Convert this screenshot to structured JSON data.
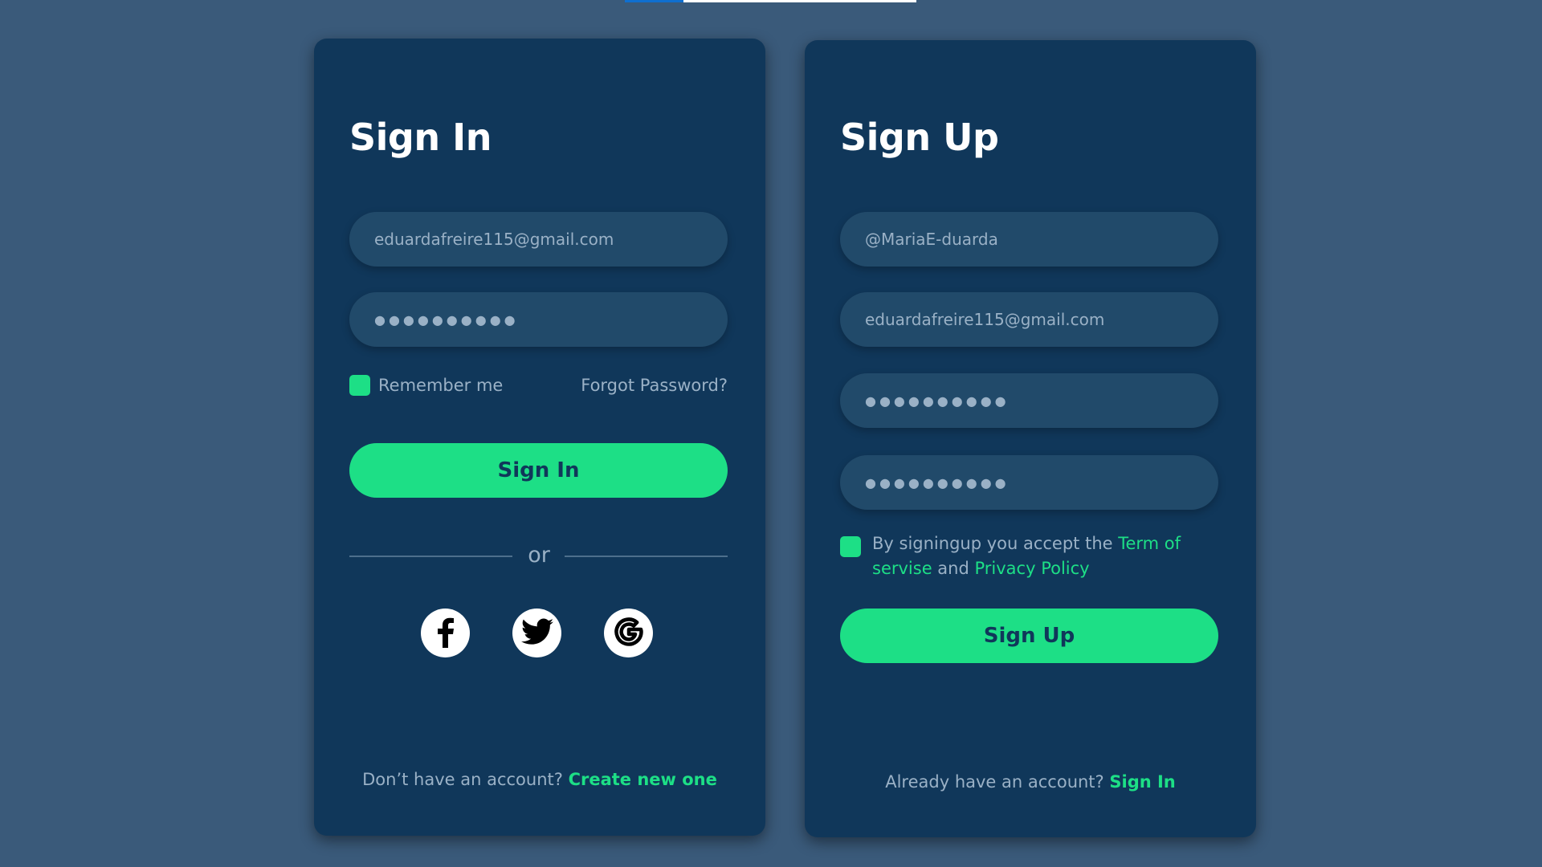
{
  "colors": {
    "background": "#3a5a7a",
    "card": "#10375a",
    "field": "#214a6a",
    "accent": "#1ddf86",
    "muted_text": "#9ab1c6"
  },
  "signin": {
    "title": "Sign In",
    "email_value": "eduardafreire115@gmail.com",
    "password_value": "●●●●●●●●●●",
    "remember_label": "Remember me",
    "forgot_label": "Forgot Password?",
    "button_label": "Sign In",
    "divider_text": "or",
    "social": [
      {
        "icon": "facebook-icon"
      },
      {
        "icon": "twitter-icon"
      },
      {
        "icon": "google-icon"
      }
    ],
    "footer_text": "Don’t have an account? ",
    "footer_link": "Create new one"
  },
  "signup": {
    "title": "Sign Up",
    "username_value": "@MariaE-duarda",
    "email_value": "eduardafreire115@gmail.com",
    "password_value": "●●●●●●●●●●",
    "confirm_password_value": "●●●●●●●●●●",
    "terms_prefix": "By signingup you accept the ",
    "terms_link": "Term of servise",
    "terms_middle": " and ",
    "privacy_link": "Privacy Policy",
    "button_label": "Sign Up",
    "footer_text": "Already have an account? ",
    "footer_link": "Sign In"
  }
}
